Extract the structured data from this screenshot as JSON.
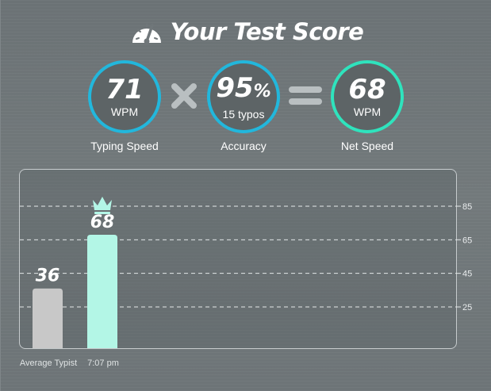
{
  "header": {
    "title": "Your Test Score",
    "icon": "speedometer-icon"
  },
  "stats": [
    {
      "value": "71",
      "sub": "WPM",
      "label": "Typing Speed",
      "color": "#22b7dc"
    },
    {
      "value": "95",
      "unit": "%",
      "sub": "15  typos",
      "label": "Accuracy",
      "color": "#22b7dc"
    },
    {
      "value": "68",
      "sub": "WPM",
      "label": "Net Speed",
      "color": "#2fe3bd"
    }
  ],
  "operators": {
    "multiply": "times-icon",
    "equals": "equals-icon"
  },
  "chart_data": {
    "type": "bar",
    "categories": [
      "Average Typist",
      "7:07 pm"
    ],
    "values": [
      36,
      68
    ],
    "colors": [
      "#c8c8c8",
      "#b3f6e6"
    ],
    "ylim": [
      0,
      100
    ],
    "yticks": [
      25,
      45,
      65,
      85
    ],
    "grid": true,
    "top_marker": "crown-icon"
  }
}
